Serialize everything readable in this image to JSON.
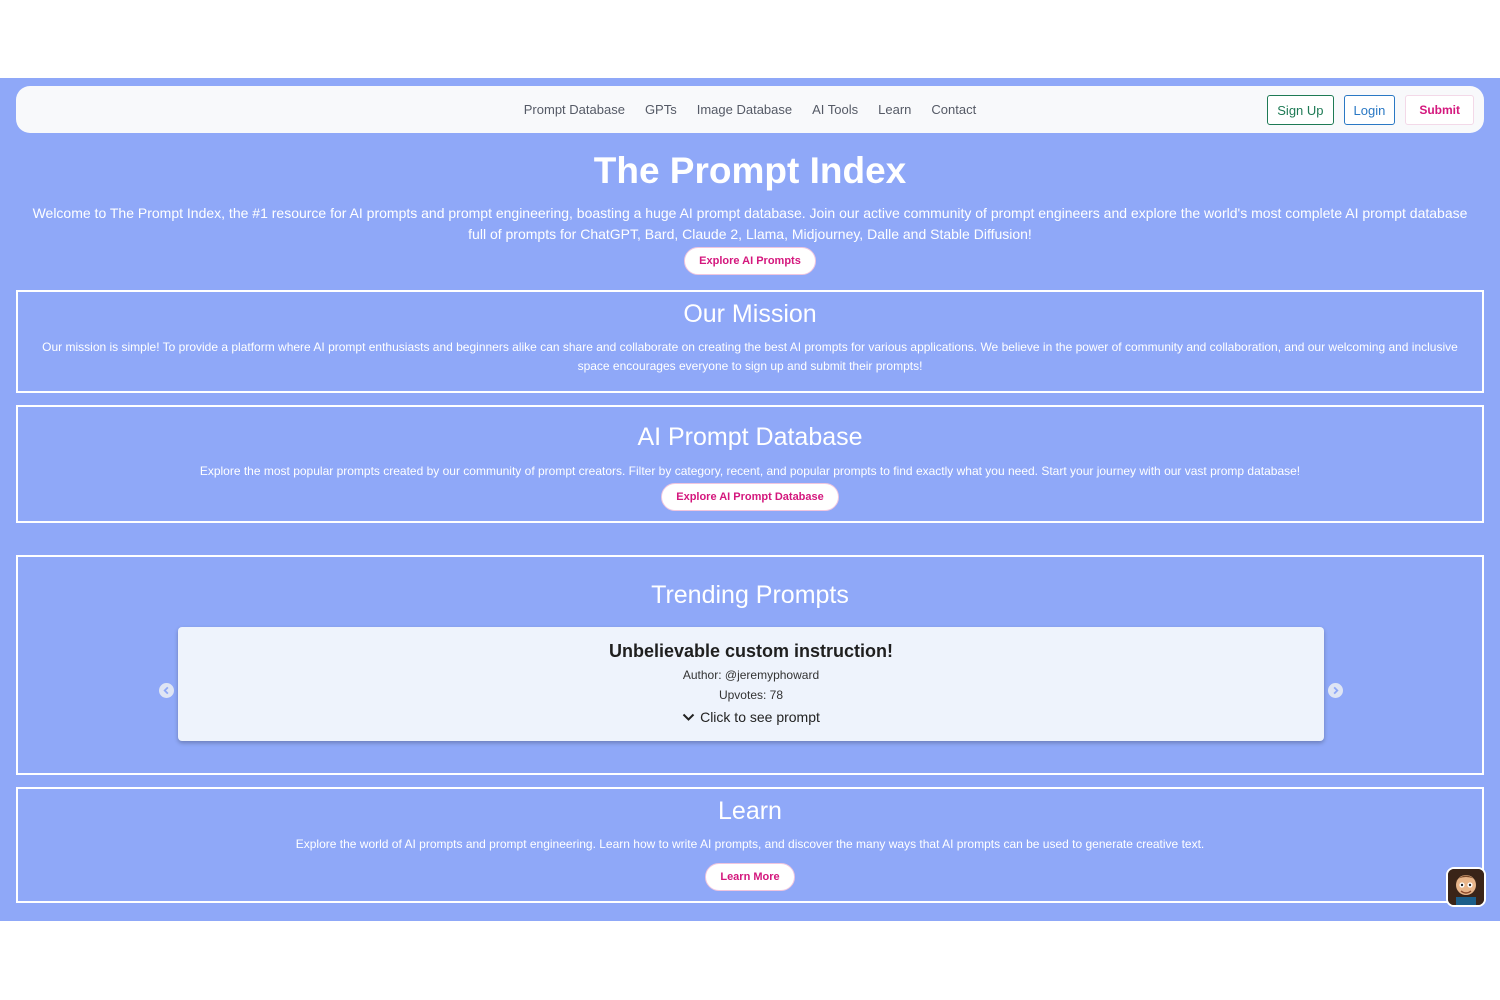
{
  "nav": {
    "links": [
      "Prompt Database",
      "GPTs",
      "Image Database",
      "AI Tools",
      "Learn",
      "Contact"
    ],
    "signup_label": "Sign Up",
    "login_label": "Login",
    "submit_label": "Submit"
  },
  "hero": {
    "title": "The Prompt Index",
    "description": "Welcome to The Prompt Index, the #1 resource for AI prompts and prompt engineering, boasting a huge AI prompt database. Join our active community of prompt engineers and explore the world's most complete AI prompt database full of prompts for ChatGPT, Bard, Claude 2, Llama, Midjourney, Dalle and Stable Diffusion!",
    "button_label": "Explore AI Prompts"
  },
  "mission": {
    "title": "Our Mission",
    "text": "Our mission is simple! To provide a platform where AI prompt enthusiasts and beginners alike can share and collaborate on creating the best AI prompts for various applications. We believe in the power of community and collaboration, and our welcoming and inclusive space encourages everyone to sign up and submit their prompts!"
  },
  "database": {
    "title": "AI Prompt Database",
    "text": "Explore the most popular prompts created by our community of prompt creators. Filter by category, recent, and popular prompts to find exactly what you need. Start your journey with our vast promp database!",
    "button_label": "Explore AI Prompt Database"
  },
  "trending": {
    "title": "Trending Prompts",
    "card": {
      "title": "Unbelievable custom instruction!",
      "author": "Author: @jeremyphoward",
      "upvotes": "Upvotes: 78",
      "toggle": "Click to see prompt"
    }
  },
  "learn": {
    "title": "Learn",
    "text": "Explore the world of AI prompts and prompt engineering. Learn how to write AI prompts, and discover the many ways that AI prompts can be used to generate creative text.",
    "button_label": "Learn More"
  },
  "icons": [
    "chevron-left-icon",
    "chevron-right-icon",
    "chevron-down-icon",
    "chat-avatar-icon"
  ],
  "colors": {
    "background": "#8fa8f8",
    "accent": "#d4177d",
    "signup": "#1e7a55",
    "login": "#2a78c4"
  }
}
